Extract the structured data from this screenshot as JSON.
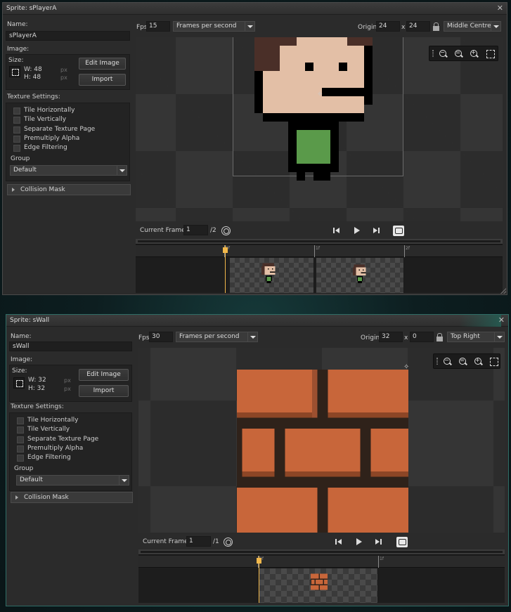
{
  "windows": [
    {
      "title": "Sprite: sPlayerA",
      "name_label": "Name:",
      "name_value": "sPlayerA",
      "image_label": "Image:",
      "size_label": "Size:",
      "width_text": "W: 48",
      "height_text": "H: 48",
      "px_unit": "px",
      "edit_image_label": "Edit Image",
      "import_label": "Import",
      "texture_settings_label": "Texture Settings:",
      "checkboxes": [
        "Tile Horizontally",
        "Tile Vertically",
        "Separate Texture Page",
        "Premultiply Alpha",
        "Edge Filtering"
      ],
      "group_label": "Group",
      "group_value": "Default",
      "collision_mask_label": "Collision Mask",
      "fps_label": "Fps",
      "fps_value": "15",
      "fps_mode": "Frames per second",
      "origin_label": "Origin",
      "origin_x": "24",
      "origin_sep": "x",
      "origin_y": "24",
      "origin_preset": "Middle Centre",
      "current_frame_label": "Current Frame:",
      "current_frame_value": "1",
      "frame_total": "/2",
      "timeline_ticks": [
        "0f",
        "1f",
        "2f"
      ],
      "zoom_level": 1.0
    },
    {
      "title": "Sprite: sWall",
      "name_label": "Name:",
      "name_value": "sWall",
      "image_label": "Image:",
      "size_label": "Size:",
      "width_text": "W: 32",
      "height_text": "H: 32",
      "px_unit": "px",
      "edit_image_label": "Edit Image",
      "import_label": "Import",
      "texture_settings_label": "Texture Settings:",
      "checkboxes": [
        "Tile Horizontally",
        "Tile Vertically",
        "Separate Texture Page",
        "Premultiply Alpha",
        "Edge Filtering"
      ],
      "group_label": "Group",
      "group_value": "Default",
      "collision_mask_label": "Collision Mask",
      "fps_label": "Fps",
      "fps_value": "30",
      "fps_mode": "Frames per second",
      "origin_label": "Origin",
      "origin_x": "32",
      "origin_sep": "x",
      "origin_y": "0",
      "origin_preset": "Top Right",
      "current_frame_label": "Current Frame:",
      "current_frame_value": "1",
      "frame_total": "/1",
      "timeline_ticks": [
        "0f",
        "1f"
      ]
    }
  ],
  "colors": {
    "accent_playhead": "#f2b84a",
    "brick": "#c8663a",
    "shirt": "#5a9a4a",
    "skin": "#e3bfa6",
    "hair": "#4a2f28"
  },
  "icons": {
    "close": "close-icon",
    "lock": "lock-icon",
    "onion_skin": "onion-skin-icon",
    "zoom_out": "zoom-out-icon",
    "zoom_reset": "zoom-reset-icon",
    "zoom_in": "zoom-in-icon",
    "fit": "fit-to-window-icon"
  }
}
